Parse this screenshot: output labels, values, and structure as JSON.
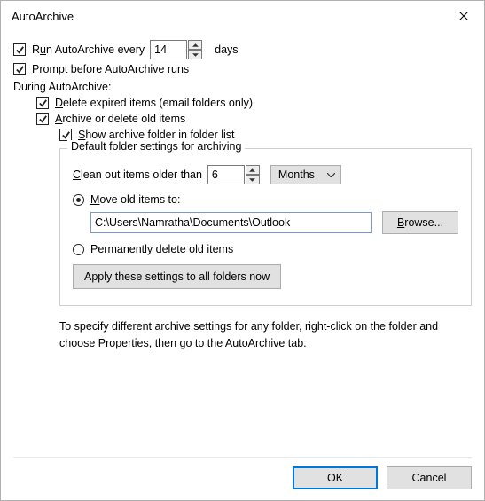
{
  "window": {
    "title": "AutoArchive"
  },
  "main": {
    "runEvery": {
      "checked": true,
      "pre": "R",
      "u": "u",
      "post": "n AutoArchive every",
      "value": "14",
      "days": "days"
    },
    "prompt": {
      "checked": true,
      "pre": "",
      "u": "P",
      "post": "rompt before AutoArchive runs"
    },
    "duringHeader": "During AutoArchive:",
    "deleteExpired": {
      "checked": true,
      "pre": "",
      "u": "D",
      "post": "elete expired items (email folders only)"
    },
    "archiveOld": {
      "checked": true,
      "pre": "",
      "u": "A",
      "post": "rchive or delete old items"
    },
    "showFolder": {
      "checked": true,
      "pre": "",
      "u": "S",
      "post": "how archive folder in folder list"
    }
  },
  "group": {
    "title": "Default folder settings for archiving",
    "clean": {
      "pre": "",
      "u": "C",
      "post": "lean out items older than",
      "value": "6",
      "unit": "Months"
    },
    "move": {
      "checked": true,
      "pre": "",
      "u": "M",
      "post": "ove old items to:"
    },
    "path": "C:\\Users\\Namratha\\Documents\\Outlook",
    "browse": {
      "pre": "",
      "u": "B",
      "post": "rowse..."
    },
    "perm": {
      "checked": false,
      "pre": "P",
      "u": "e",
      "post": "rmanently delete old items"
    },
    "apply": "Apply these settings to all folders now"
  },
  "note": "To specify different archive settings for any folder, right-click on the folder and choose Properties, then go to the AutoArchive tab.",
  "footer": {
    "ok": "OK",
    "cancel": "Cancel"
  }
}
